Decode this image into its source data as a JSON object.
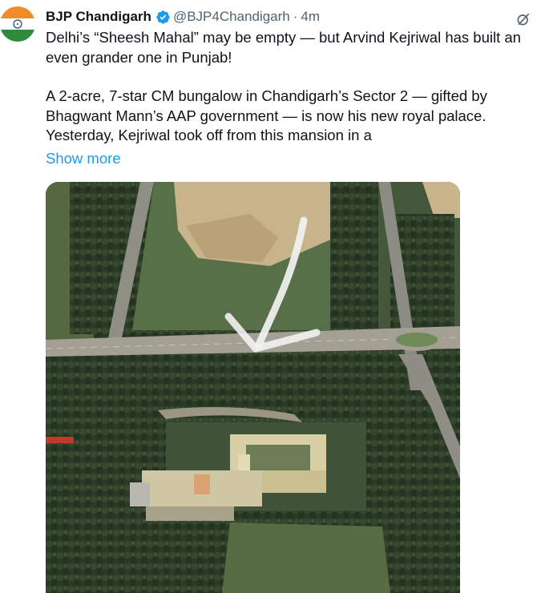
{
  "tweet": {
    "author_name": "BJP Chandigarh",
    "handle": "@BJP4Chandigarh",
    "separator": "·",
    "time": "4m",
    "lines": [
      "Delhi’s “Sheesh Mahal” may be empty — but Arvind Kejriwal has built an",
      "even grander one in Punjab!",
      "A 2-acre, 7-star CM bungalow in Chandigarh’s Sector 2 — gifted by",
      "Bhagwant Mann’s AAP government — is now his new royal palace.",
      "Yesterday, Kejriwal took off from this mansion in a"
    ],
    "show_more": "Show more"
  },
  "icons": {
    "avatar": "india-flag-avatar",
    "verified": "verified-badge-icon",
    "grok": "grok-icon"
  },
  "colors": {
    "text": "#0f1419",
    "secondary": "#536471",
    "link": "#1d9bf0",
    "verified": "#1d9bf0"
  }
}
